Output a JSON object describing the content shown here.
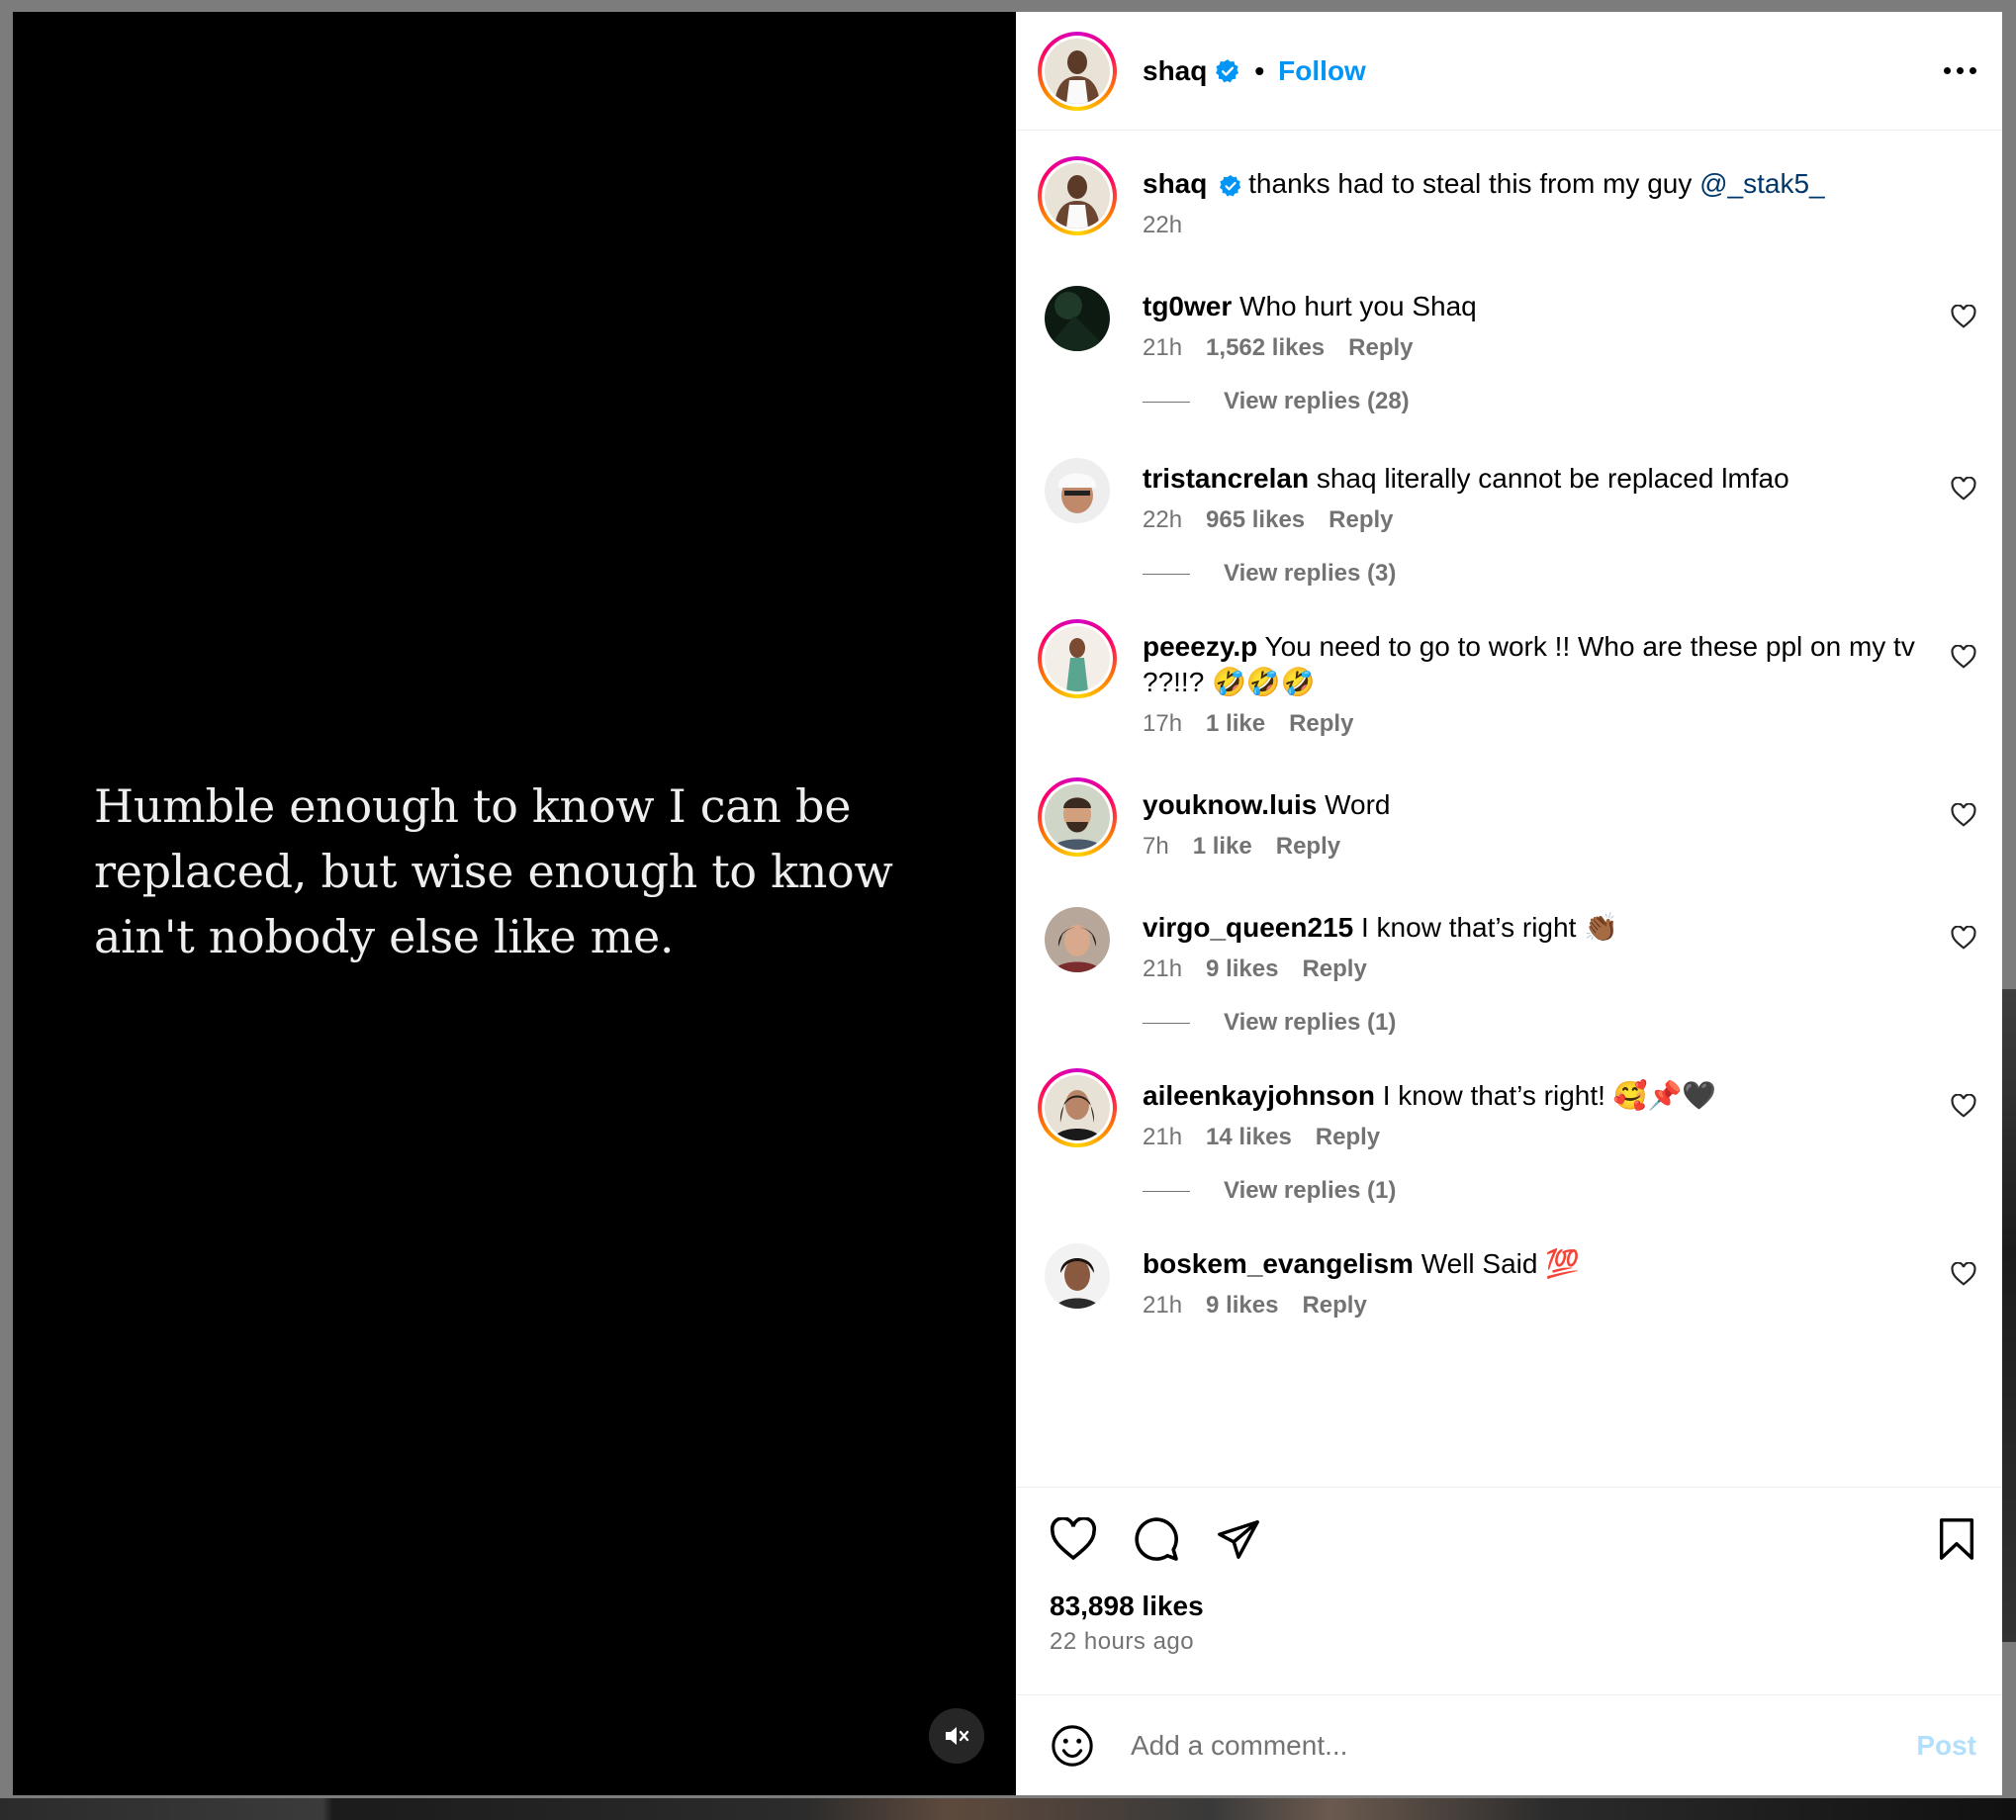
{
  "post": {
    "quote_text": "Humble enough to know I can be replaced, but wise enough to know ain't nobody else like me.",
    "author": "shaq",
    "follow_label": "Follow",
    "separator": "•",
    "caption_user": "shaq",
    "caption_text": "thanks had to steal this from my guy ",
    "caption_mention": "@_stak5_",
    "caption_time": "22h",
    "likes": "83,898 likes",
    "time_ago": "22 hours ago",
    "add_comment_placeholder": "Add a comment...",
    "post_label": "Post"
  },
  "colors": {
    "accent": "#0095f6",
    "verified": "#0095f6",
    "secondary_text": "#737373",
    "media_bg": "#000000"
  },
  "comments": [
    {
      "user": "tg0wer",
      "text": "Who hurt you Shaq",
      "time": "21h",
      "likes": "1,562 likes",
      "reply": "Reply",
      "replies": "View replies (28)"
    },
    {
      "user": "tristancrelan",
      "text": "shaq literally cannot be replaced lmfao",
      "time": "22h",
      "likes": "965 likes",
      "reply": "Reply",
      "replies": "View replies (3)"
    },
    {
      "user": "peeezy.p",
      "text": "You need to go to work !! Who are these ppl on my tv ??!!? 🤣🤣🤣",
      "time": "17h",
      "likes": "1 like",
      "reply": "Reply"
    },
    {
      "user": "youknow.luis",
      "text": "Word",
      "time": "7h",
      "likes": "1 like",
      "reply": "Reply"
    },
    {
      "user": "virgo_queen215",
      "text": "I know that’s right 👏🏾",
      "time": "21h",
      "likes": "9 likes",
      "reply": "Reply",
      "replies": "View replies (1)"
    },
    {
      "user": "aileenkayjohnson",
      "text": "I know that’s right! 🥰📌🖤",
      "time": "21h",
      "likes": "14 likes",
      "reply": "Reply",
      "replies": "View replies (1)"
    },
    {
      "user": "boskem_evangelism",
      "text": "Well Said 💯",
      "time": "21h",
      "likes": "9 likes",
      "reply": "Reply"
    }
  ],
  "icons": {
    "header": [
      "verified-badge-icon",
      "more-options-icon"
    ],
    "actions": [
      "heart-icon",
      "comment-icon",
      "share-icon",
      "bookmark-icon"
    ],
    "media": [
      "mute-icon"
    ],
    "composer": [
      "emoji-icon"
    ]
  }
}
